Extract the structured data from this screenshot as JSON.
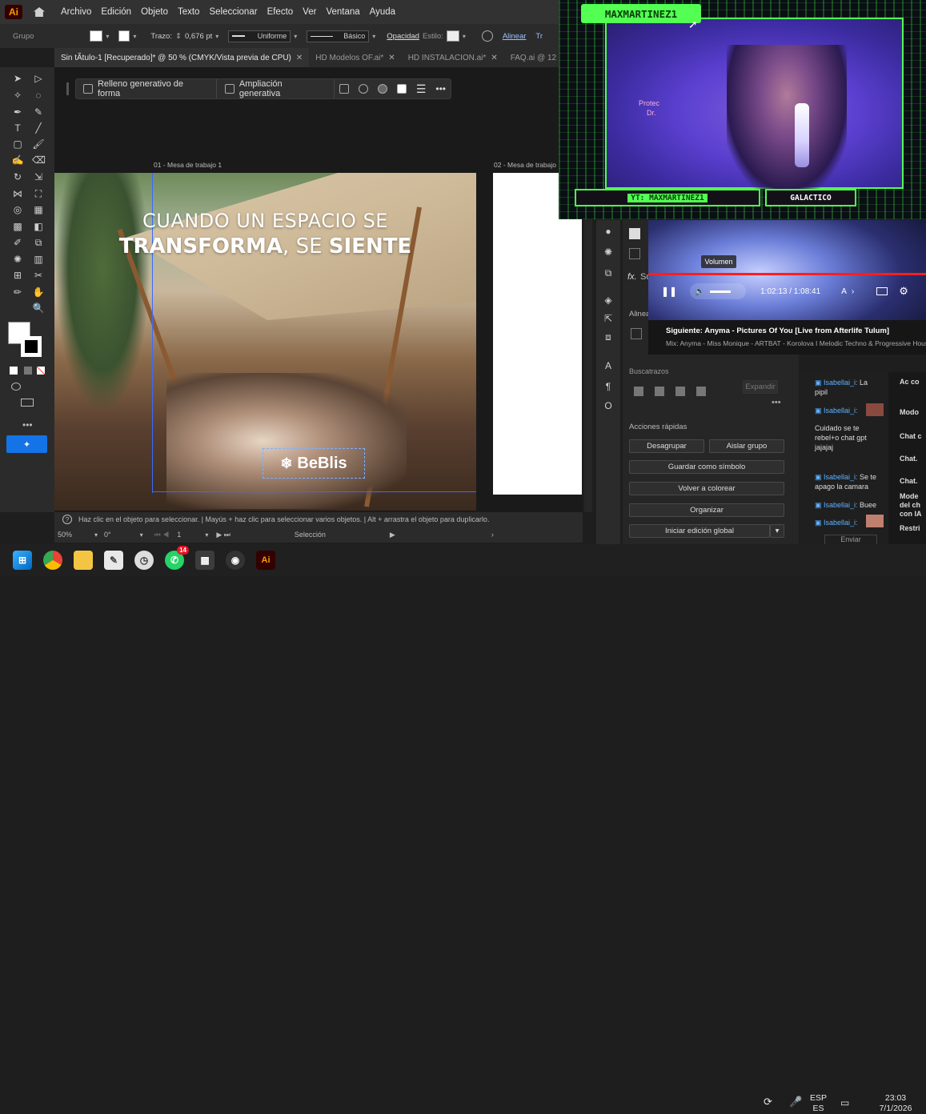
{
  "app": {
    "logo": "Ai"
  },
  "menu": [
    "Archivo",
    "Edición",
    "Objeto",
    "Texto",
    "Seleccionar",
    "Efecto",
    "Ver",
    "Ventana",
    "Ayuda"
  ],
  "control": {
    "selection_label": "Grupo",
    "stroke_label": "Trazo:",
    "stroke_value": "0,676 pt",
    "stroke_profile": "Uniforme",
    "brush": "Básico",
    "opacity_label": "Opacidad",
    "style_label": "Estilo:",
    "align_label": "Alinear",
    "extra": "Tr"
  },
  "tabs": [
    {
      "label": "Sin tÃtulo-1 [Recuperado]* @ 50 % (CMYK/Vista previa de CPU)",
      "active": true
    },
    {
      "label": "HD Modelos OF.ai*",
      "active": false
    },
    {
      "label": "HD INSTALACION.ai*",
      "active": false
    },
    {
      "label": "FAQ.ai @ 12",
      "active": false
    }
  ],
  "context_bar": {
    "item1": "Relleno generativo de forma",
    "item2": "Ampliación generativa"
  },
  "artboards": {
    "a1": "01 - Mesa de trabajo 1",
    "a2": "02 - Mesa de trabajo"
  },
  "artwork": {
    "line1": "CUANDO UN ESPACIO SE",
    "line2_bold1": "TRANSFORMA",
    "line2_mid": ", SE ",
    "line2_bold2": "SIENTE",
    "logo_text": "BeBlis"
  },
  "status": {
    "hint": "Haz clic en el objeto para seleccionar.  |  Mayús + haz clic para seleccionar varios objetos.  |  Alt + arrastra el objeto para duplicarlo.",
    "zoom": "50%",
    "angle": "0°",
    "artboard_num": "1",
    "tool": "Selección"
  },
  "properties": {
    "fx": "fx.",
    "so": "So",
    "align": "Alinea",
    "buscar": "Buscatrazos",
    "quick_actions": "Acciones rápidas",
    "ungroup": "Desagrupar",
    "isolate": "Aislar grupo",
    "save_symbol": "Guardar como símbolo",
    "recolor": "Volver a colorear",
    "arrange": "Organizar",
    "global_edit": "Iniciar edición global",
    "expand": "Expandir"
  },
  "stream": {
    "name": "MAXMARTINEZ1",
    "yt": "YT: MAXMARTINEZ1",
    "tag": "GALACTICO",
    "poster_text1": "Protec",
    "poster_text2": "Dr."
  },
  "youtube": {
    "tooltip": "Volumen",
    "time": "1:02:13 / 1:08:41",
    "next_title": "Siguiente: Anyma - Pictures Of You [Live from Afterlife Tulum]",
    "next_sub": "Mix: Anyma - Miss Monique - ARTBAT - Korolova I Melodic Techno & Progressive House M",
    "caption_label": "A"
  },
  "chat": {
    "messages": [
      {
        "name": "Isabellai_i:",
        "text": " La pipil"
      },
      {
        "name": "Isabellai_i:",
        "text": ""
      },
      {
        "name": "",
        "text": "Cuidado se te rebel+o chat gpt jajajaj"
      },
      {
        "name": "Isabellai_i:",
        "text": " Se te apago la camara"
      },
      {
        "name": "Isabellai_i:",
        "text": " Buee"
      },
      {
        "name": "Isabellai_i:",
        "text": ""
      }
    ],
    "send": "Enviar",
    "side_items": [
      "Ac co",
      "Modo",
      "Chat c",
      "Chat.",
      "Chat.",
      "Mode del ch con IA",
      "Restri"
    ]
  },
  "taskbar": {
    "lang1": "ESP",
    "lang2": "ES",
    "time": "23:03",
    "date": "7/1/2026",
    "whatsapp_badge": "14"
  }
}
